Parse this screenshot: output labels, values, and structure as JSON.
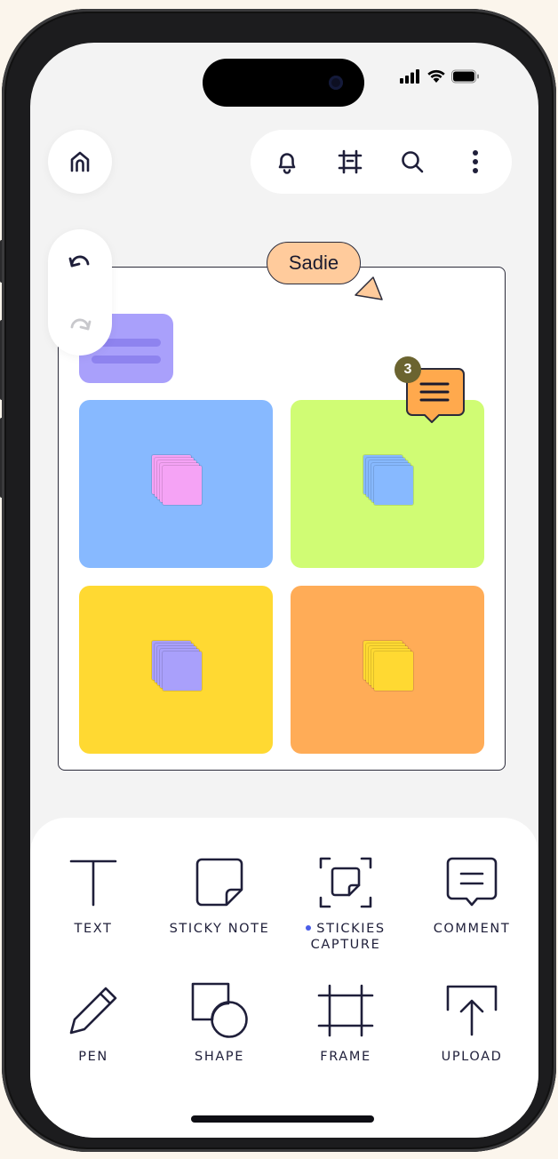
{
  "collaborator": {
    "name": "Sadie",
    "color": "#ffcb9c"
  },
  "comment": {
    "count": "3",
    "color": "#ffa94d"
  },
  "top_bar": {
    "home_icon": "home-icon",
    "notifications_icon": "bell-icon",
    "frames_icon": "frame-icon",
    "search_icon": "search-icon",
    "more_icon": "more-vertical-icon"
  },
  "history": {
    "undo_icon": "undo-icon",
    "redo_icon": "redo-icon",
    "redo_enabled": false
  },
  "board": {
    "quadrants": [
      {
        "color": "#87b9ff",
        "sticky_color": "#f5a3f5"
      },
      {
        "color": "#d0fc74",
        "sticky_color": "#87b9ff"
      },
      {
        "color": "#ffd932",
        "sticky_color": "#a9a0fb"
      },
      {
        "color": "#ffac57",
        "sticky_color": "#ffd932"
      }
    ]
  },
  "tools": [
    {
      "label": "TEXT",
      "icon": "text-icon"
    },
    {
      "label": "STICKY NOTE",
      "icon": "sticky-note-icon"
    },
    {
      "label": "STICKIES",
      "label2": "CAPTURE",
      "icon": "stickies-capture-icon",
      "new": true
    },
    {
      "label": "COMMENT",
      "icon": "comment-icon"
    },
    {
      "label": "PEN",
      "icon": "pen-icon"
    },
    {
      "label": "SHAPE",
      "icon": "shape-icon"
    },
    {
      "label": "FRAME",
      "icon": "frame-icon"
    },
    {
      "label": "UPLOAD",
      "icon": "upload-icon"
    }
  ]
}
